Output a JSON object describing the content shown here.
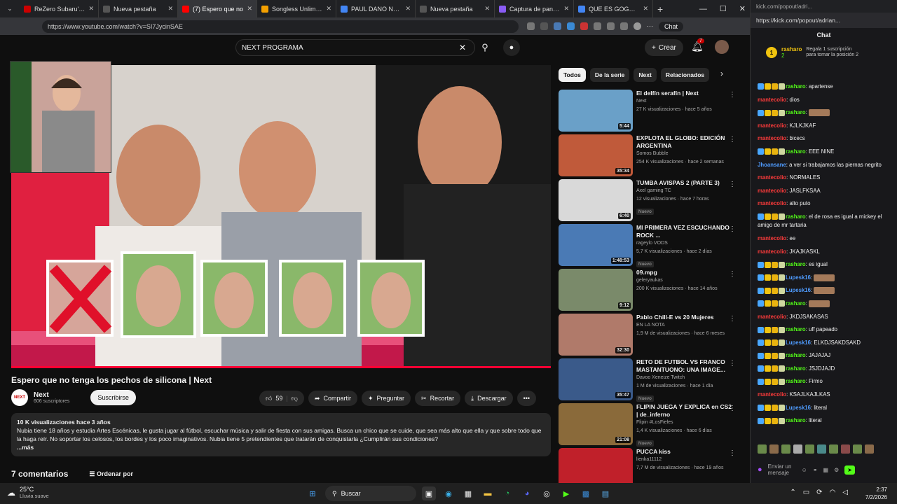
{
  "browser": {
    "tabs": [
      {
        "label": "ReZero Subaru's Tuff Sl",
        "color": "#c00"
      },
      {
        "label": "Nueva pestaña",
        "color": "#555"
      },
      {
        "label": "(7) Espero que no",
        "color": "#f00",
        "active": true
      },
      {
        "label": "Songless Unlimited",
        "color": "#f4a000"
      },
      {
        "label": "PAUL DANO NOVIA - B",
        "color": "#4285f4"
      },
      {
        "label": "Nueva pestaña",
        "color": "#555"
      },
      {
        "label": "Captura de pantalla p",
        "color": "#8a5cf5"
      },
      {
        "label": "QUE ES GOGO JERGA F",
        "color": "#4285f4"
      }
    ],
    "new_tab": "+",
    "win_min": "—",
    "win_max": "☐",
    "win_close": "✕",
    "url": "https://www.youtube.com/watch?v=SI7JycinSAE",
    "chat_btn": "Chat"
  },
  "youtube": {
    "search_value": "NEXT  PROGRAMA",
    "search_clear": "✕",
    "create_label": "Crear",
    "notif_count": "7",
    "video_title": "Espero que no tenga los pechos de silicona | Next",
    "channel": {
      "name": "Next",
      "subs": "606 suscriptores",
      "logo_text": "NEXT"
    },
    "subscribe": "Suscribirse",
    "actions": {
      "likes": "59",
      "share": "Compartir",
      "ask": "Preguntar",
      "clip": "Recortar",
      "download": "Descargar",
      "more": "•••"
    },
    "description": {
      "meta": "10 K visualizaciones  hace 3 años",
      "text": "Nubia tiene 18 años y estudia Artes Escénicas, le gusta jugar al fútbol, escuchar música y salir de fiesta con sus amigas. Busca un chico que se cuide, que sea más alto que ella y que sobre todo que la haga reír. No soportar los celosos, los bordes y los poco imaginativos. Nubia tiene 5 pretendientes que tratarán de conquistarla ¿Cumplirán sus condiciones?",
      "more": "...más"
    },
    "comments": {
      "title": "7 comentarios",
      "sort": "Ordenar por"
    },
    "chips": [
      "Todos",
      "De la serie",
      "Next",
      "Relacionados"
    ],
    "recs": [
      {
        "title": "El delfín serafín | Next",
        "channel": "Next",
        "meta": "27 K visualizaciones · hace 5 años",
        "dur": "5:44",
        "color": "#6aa0c8",
        "new": ""
      },
      {
        "title": "EXPLOTA EL GLOBO: EDICIÓN ARGENTINA",
        "channel": "Somos Bubble",
        "meta": "254 K visualizaciones · hace 2 semanas",
        "dur": "35:34",
        "color": "#c05a3a",
        "new": ""
      },
      {
        "title": "TUMBA AVISPAS 2 (PARTE 3)",
        "channel": "Axel gaming TC",
        "meta": "12 visualizaciones · hace 7 horas",
        "dur": "6:40",
        "color": "#d9d9d9",
        "new": "Nuevo"
      },
      {
        "title": "MI PRIMERA VEZ ESCUCHANDO ROCK ...",
        "channel": "rageylo VODS",
        "meta": "5,7 K visualizaciones · hace 2 días",
        "dur": "1:48:53",
        "color": "#4a7ab5",
        "new": "Nuevo"
      },
      {
        "title": "09.mpg",
        "channel": "geleryaukas",
        "meta": "200 K visualizaciones · hace 14 años",
        "dur": "9:12",
        "color": "#7a8a6a",
        "new": ""
      },
      {
        "title": "Pablo Chill-E vs 20 Mujeres",
        "channel": "EN LA NOTA",
        "meta": "1,9 M de visualizaciones · hace 6 meses",
        "dur": "32:30",
        "color": "#b07a6a",
        "new": ""
      },
      {
        "title": "RETO DE FUTBOL VS FRANCO MASTANTUONO: UNA IMAGE...",
        "channel": "Davoo Xeneize Twitch",
        "meta": "1 M de visualizaciones · hace 1 día",
        "dur": "35:47",
        "color": "#3a5a8a",
        "new": "Nuevo"
      },
      {
        "title": "FLIPIN JUEGA Y EXPLICA en CS2 | de_inferno",
        "channel": "Flipin #LosFieles",
        "meta": "1,4 K visualizaciones · hace 6 días",
        "dur": "21:08",
        "color": "#8a6a3a",
        "new": "Nuevo"
      },
      {
        "title": "PUCCA kiss",
        "channel": "lienka11112",
        "meta": "7,7 M de visualizaciones · hace 19 años",
        "dur": "",
        "color": "#c0202a",
        "new": ""
      }
    ]
  },
  "kick": {
    "title": "kick.com/popout/adri...",
    "url": "https://kick.com/popout/adrian...",
    "chat_title": "Chat",
    "pinned_user": "rasharo",
    "pinned_count": "2",
    "pinned_text": "Regala 1 suscripción para tomar la posición 2",
    "messages": [
      {
        "user": "rasharo",
        "cls": "u-r",
        "text": "apartense",
        "badges": true
      },
      {
        "user": "mantecolio",
        "cls": "u-m",
        "text": "dios",
        "badges": false
      },
      {
        "user": "rasharo",
        "cls": "u-r",
        "text": "",
        "badges": true,
        "emote": true
      },
      {
        "user": "mantecolio",
        "cls": "u-m",
        "text": "KJLKJKAF",
        "badges": false
      },
      {
        "user": "mantecolio",
        "cls": "u-m",
        "text": "bicecs",
        "badges": false
      },
      {
        "user": "rasharo",
        "cls": "u-r",
        "text": "EEE NINE",
        "badges": true
      },
      {
        "user": "Jhoansane",
        "cls": "u-j",
        "text": "a ver si trabajamos las piernas negrito",
        "badges": false
      },
      {
        "user": "mantecolio",
        "cls": "u-m",
        "text": "NORMALES",
        "badges": false
      },
      {
        "user": "mantecolio",
        "cls": "u-m",
        "text": "JASLFKSAA",
        "badges": false
      },
      {
        "user": "mantecolio",
        "cls": "u-m",
        "text": "alto puto",
        "badges": false
      },
      {
        "user": "rasharo",
        "cls": "u-r",
        "text": "el de rosa es igual a mickey el amigo de mr tartaria",
        "badges": true
      },
      {
        "user": "mantecolio",
        "cls": "u-m",
        "text": "ee",
        "badges": false
      },
      {
        "user": "mantecolio",
        "cls": "u-m",
        "text": "JKAJKASKL",
        "badges": false
      },
      {
        "user": "rasharo",
        "cls": "u-r",
        "text": "es igual",
        "badges": true
      },
      {
        "user": "Lupesk16",
        "cls": "u-l",
        "text": "",
        "badges": true,
        "emote": true
      },
      {
        "user": "Lupesk16",
        "cls": "u-l",
        "text": "",
        "badges": true,
        "emote": true
      },
      {
        "user": "rasharo",
        "cls": "u-r",
        "text": "",
        "badges": true,
        "emote": true
      },
      {
        "user": "mantecolio",
        "cls": "u-m",
        "text": "JKDJSAKASAS",
        "badges": false
      },
      {
        "user": "rasharo",
        "cls": "u-r",
        "text": "uff papeado",
        "badges": true
      },
      {
        "user": "Lupesk16",
        "cls": "u-l",
        "text": "ELKDJSAKDSAKD",
        "badges": true
      },
      {
        "user": "rasharo",
        "cls": "u-r",
        "text": "JAJAJAJ",
        "badges": true
      },
      {
        "user": "rasharo",
        "cls": "u-r",
        "text": "JSJDJAJD",
        "badges": true
      },
      {
        "user": "rasharo",
        "cls": "u-r",
        "text": "Firmo",
        "badges": true
      },
      {
        "user": "mantecolio",
        "cls": "u-m",
        "text": "KSAJLKAJLKAS",
        "badges": false
      },
      {
        "user": "Lupesk16",
        "cls": "u-l",
        "text": "literal",
        "badges": true
      },
      {
        "user": "rasharo",
        "cls": "u-r",
        "text": "literal",
        "badges": true
      }
    ],
    "input_placeholder": "Enviar un mensaje"
  },
  "taskbar": {
    "temp": "25°C",
    "weather": "Lluvia suave",
    "search": "Buscar",
    "time": "2:37",
    "date": "7/2/2026"
  }
}
